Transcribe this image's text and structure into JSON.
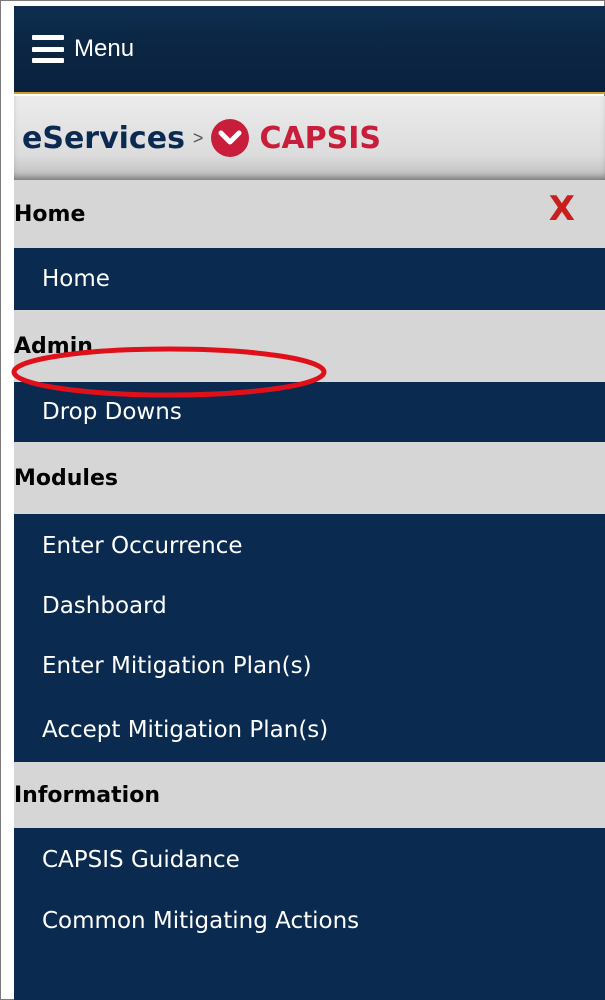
{
  "topbar": {
    "menu_label": "Menu"
  },
  "breadcrumb": {
    "root": "eServices",
    "separator": ">",
    "current": "CAPSIS"
  },
  "nav": {
    "close_label": "X",
    "sections": [
      {
        "header": "Home",
        "items": [
          "Home"
        ]
      },
      {
        "header": "Admin",
        "items": [
          "Drop Downs"
        ]
      },
      {
        "header": "Modules",
        "items": [
          "Enter Occurrence",
          "Dashboard",
          "Enter Mitigation Plan(s)",
          "Accept Mitigation Plan(s)"
        ]
      },
      {
        "header": "Information",
        "items": [
          "CAPSIS Guidance",
          "Common Mitigating Actions"
        ]
      }
    ]
  },
  "colors": {
    "nav_bg": "#0a2a4f",
    "section_bg": "#d6d6d6",
    "accent_red": "#c81e3c",
    "gold_rule": "#c9a227",
    "annotation_red": "#e0101a"
  },
  "annotation": {
    "highlighted_item": "Enter Occurrence"
  }
}
